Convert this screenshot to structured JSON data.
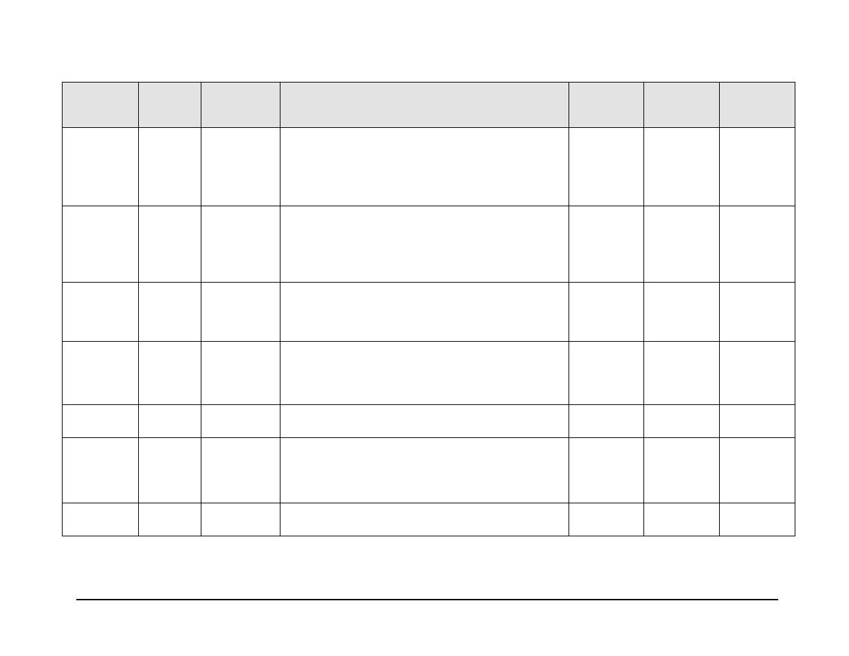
{
  "table": {
    "headers": [
      "",
      "",
      "",
      "",
      "",
      "",
      ""
    ],
    "rows": [
      [
        "",
        "",
        "",
        "",
        "",
        "",
        ""
      ],
      [
        "",
        "",
        "",
        "",
        "",
        "",
        ""
      ],
      [
        "",
        "",
        "",
        "",
        "",
        "",
        ""
      ],
      [
        "",
        "",
        "",
        "",
        "",
        "",
        ""
      ],
      [
        "",
        "",
        "",
        "",
        "",
        "",
        ""
      ],
      [
        "",
        "",
        "",
        "",
        "",
        "",
        ""
      ],
      [
        "",
        "",
        "",
        "",
        "",
        "",
        ""
      ]
    ]
  }
}
